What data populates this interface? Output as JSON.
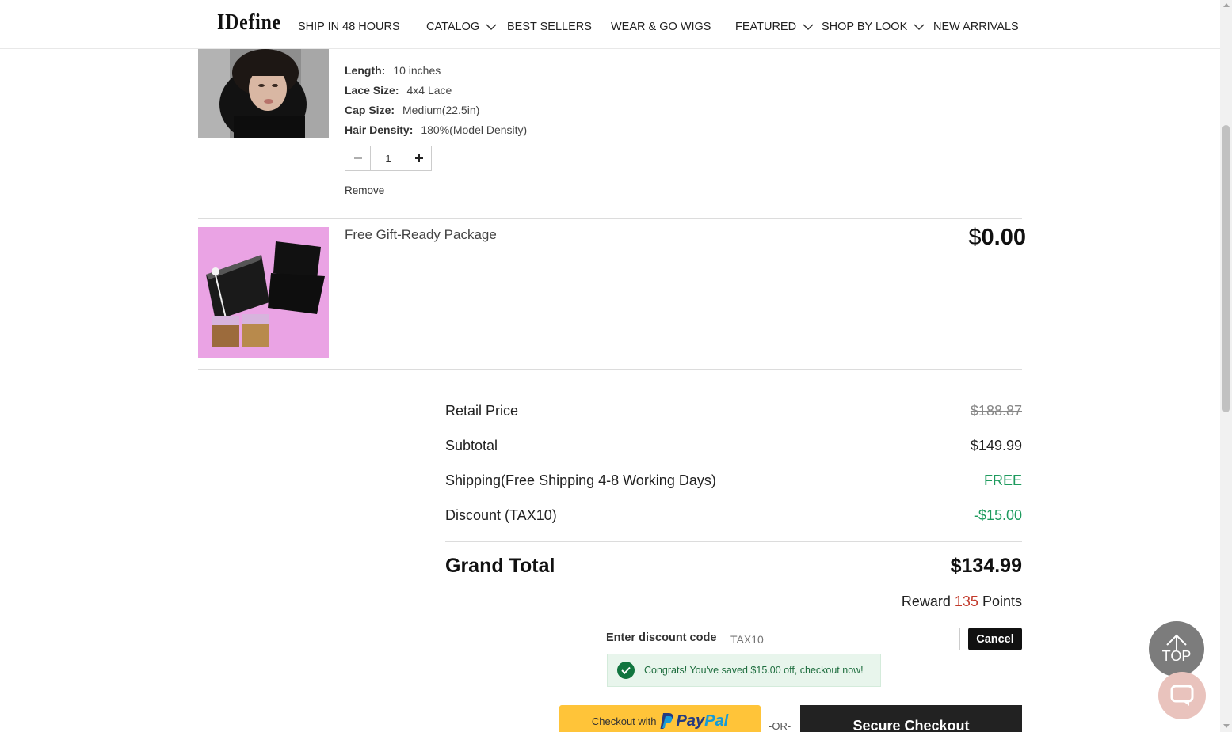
{
  "header": {
    "logo": "IDefine",
    "nav": [
      {
        "label": "SHIP IN 48 HOURS"
      },
      {
        "label": "CATALOG"
      },
      {
        "label": "BEST SELLERS"
      },
      {
        "label": "WEAR & GO WIGS"
      },
      {
        "label": "FEATURED"
      },
      {
        "label": "SHOP BY LOOK"
      },
      {
        "label": "NEW ARRIVALS"
      }
    ]
  },
  "cart": {
    "item1": {
      "attributes": [
        {
          "label": "Length:",
          "value": "10 inches"
        },
        {
          "label": "Lace Size:",
          "value": "4x4 Lace"
        },
        {
          "label": "Cap Size:",
          "value": "Medium(22.5in)"
        },
        {
          "label": "Hair Density:",
          "value": "180%(Model Density)"
        }
      ],
      "quantity": "1",
      "remove_label": "Remove"
    },
    "item2": {
      "title": "Free Gift-Ready Package",
      "price_currency": "$",
      "price_amount": "0.00"
    }
  },
  "summary": {
    "retail_label": "Retail Price",
    "retail_value": "$188.87",
    "subtotal_label": "Subtotal",
    "subtotal_value": "$149.99",
    "shipping_label": "Shipping(Free Shipping 4-8 Working Days)",
    "shipping_value": "FREE",
    "discount_label": "Discount (TAX10)",
    "discount_value": "-$15.00",
    "grand_label": "Grand Total",
    "grand_value": "$134.99",
    "reward_prefix": "Reward",
    "reward_points": "135",
    "reward_suffix": "Points"
  },
  "discount": {
    "label": "Enter discount code",
    "placeholder": "TAX10",
    "cancel_label": "Cancel",
    "success_message": "Congrats! You've saved $15.00 off, checkout now!"
  },
  "checkout": {
    "paypal_prefix": "Checkout with",
    "paypal_word1": "Pay",
    "paypal_word2": "Pal",
    "or_label": "-OR-",
    "secure_label": "Secure Checkout"
  },
  "floating": {
    "top_label": "TOP"
  },
  "colors": {
    "accent_green": "#1e9b5e",
    "reward_red": "#c23a2b",
    "paypal_yellow": "#ffc439",
    "button_dark": "#222222"
  }
}
